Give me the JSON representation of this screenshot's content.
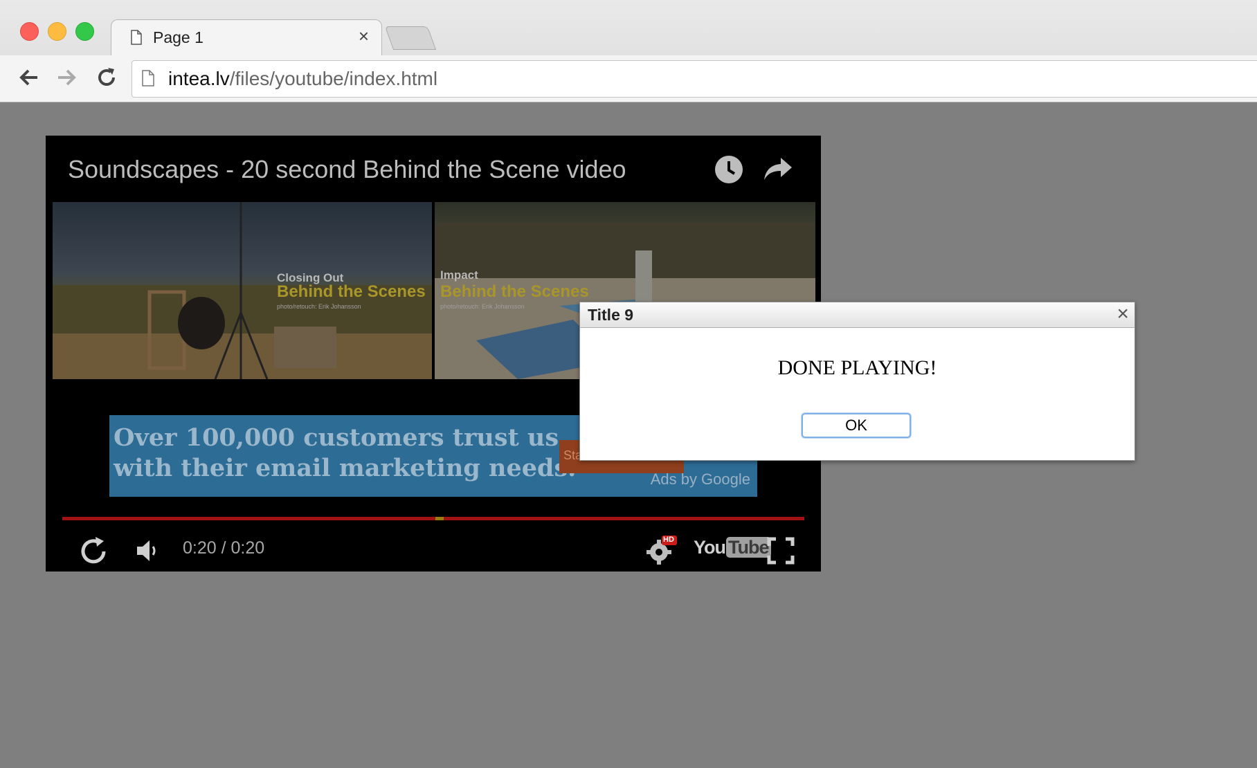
{
  "browser": {
    "tab_title": "Page 1",
    "tab_close": "×",
    "url_host": "intea.lv",
    "url_path": "/files/youtube/index.html"
  },
  "player": {
    "title": "Soundscapes - 20 second Behind the Scene video",
    "thumbnails": [
      {
        "subtitle": "Closing Out",
        "heading": "Behind  the  Scenes",
        "credit": "photo/retouch: Erik Johansson"
      },
      {
        "subtitle": "Impact",
        "heading": "Behind the Scenes",
        "credit": "photo/retouch: Erik Johansson"
      }
    ],
    "ad": {
      "line1": "Over 100,000 customers trust us",
      "line2": "with their email marketing needs.",
      "cta": "Sta",
      "ads_by": "Ads by Google"
    },
    "progress_fraction": 1.0,
    "time": "0:20 / 0:20",
    "logo_you": "You",
    "logo_tube": "Tube",
    "hd_badge": "HD"
  },
  "dialog": {
    "title": "Title 9",
    "close": "×",
    "message": "DONE PLAYING!",
    "ok_label": "OK"
  },
  "colors": {
    "background": "#7f7f7f",
    "progress": "#a11313",
    "ad_background": "#2c6c95",
    "ok_border": "#7fb0e8"
  },
  "icons": {
    "tab": "page-icon",
    "back": "arrow-left-icon",
    "forward": "arrow-right-icon",
    "reload": "reload-icon",
    "clock": "watch-later-icon",
    "share": "share-icon",
    "replay": "replay-icon",
    "volume": "volume-icon",
    "settings": "settings-gear-icon",
    "fullscreen": "fullscreen-icon"
  }
}
